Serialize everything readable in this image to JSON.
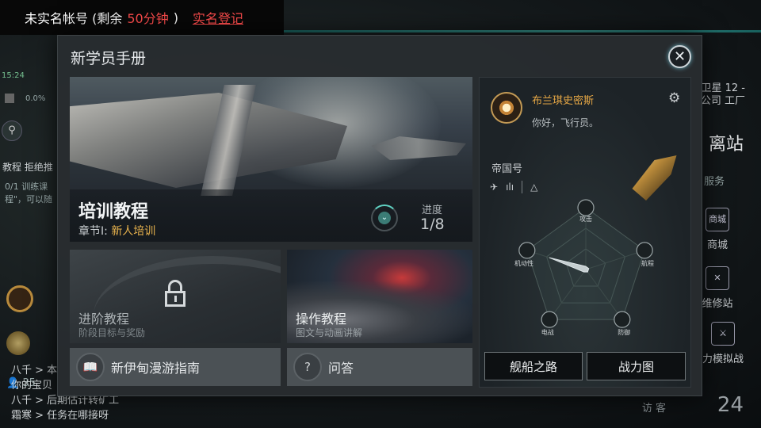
{
  "notice": {
    "prefix": "未实名帐号 (剩余",
    "remaining": "50分钟",
    "suffix": ")",
    "register_link": "实名登记"
  },
  "background": {
    "time": "15:24",
    "percent": "0.0%",
    "task_label": "教程 拒绝推",
    "task_progress": "0/1 训练课",
    "task_hint": "程\"，可以随",
    "count": "35",
    "chat": [
      "八千 > 本",
      "你的宝贝",
      "八千 > 后期估计转矿工",
      "霜寒 > 任务在哪接呀"
    ],
    "sat_line1": "卫星 12 -",
    "sat_line2": "公司 工厂",
    "leave_station": "离站",
    "services": "服务",
    "store": "商城",
    "repair": "维修站",
    "sim": "力模拟战",
    "visitors": "访 客",
    "visitor_count": "24"
  },
  "dialog": {
    "title": "新学员手册",
    "close_icon": "close-icon"
  },
  "tutorial": {
    "title": "培训教程",
    "chapter_prefix": "章节I:",
    "chapter_name": "新人培训",
    "progress_label": "进度",
    "progress_value": "1/8"
  },
  "advanced": {
    "title": "进阶教程",
    "desc": "阶段目标与奖励"
  },
  "operation": {
    "title": "操作教程",
    "desc": "图文与动画讲解"
  },
  "guide_button": "新伊甸漫游指南",
  "qa_button": "问答",
  "pilot": {
    "name": "布兰琪史密斯",
    "greeting": "你好，飞行员。"
  },
  "ship": {
    "name": "帝国号"
  },
  "chart_data": {
    "type": "radar",
    "axes": [
      "攻击",
      "航程",
      "防御",
      "电战",
      "机动性"
    ],
    "values": [
      0.05,
      0.05,
      0.05,
      0.05,
      0.62
    ],
    "max": 1,
    "ring_count": 3,
    "accent_color": "#dfe7ea"
  },
  "panel_buttons": {
    "road": "舰船之路",
    "power": "战力图"
  }
}
